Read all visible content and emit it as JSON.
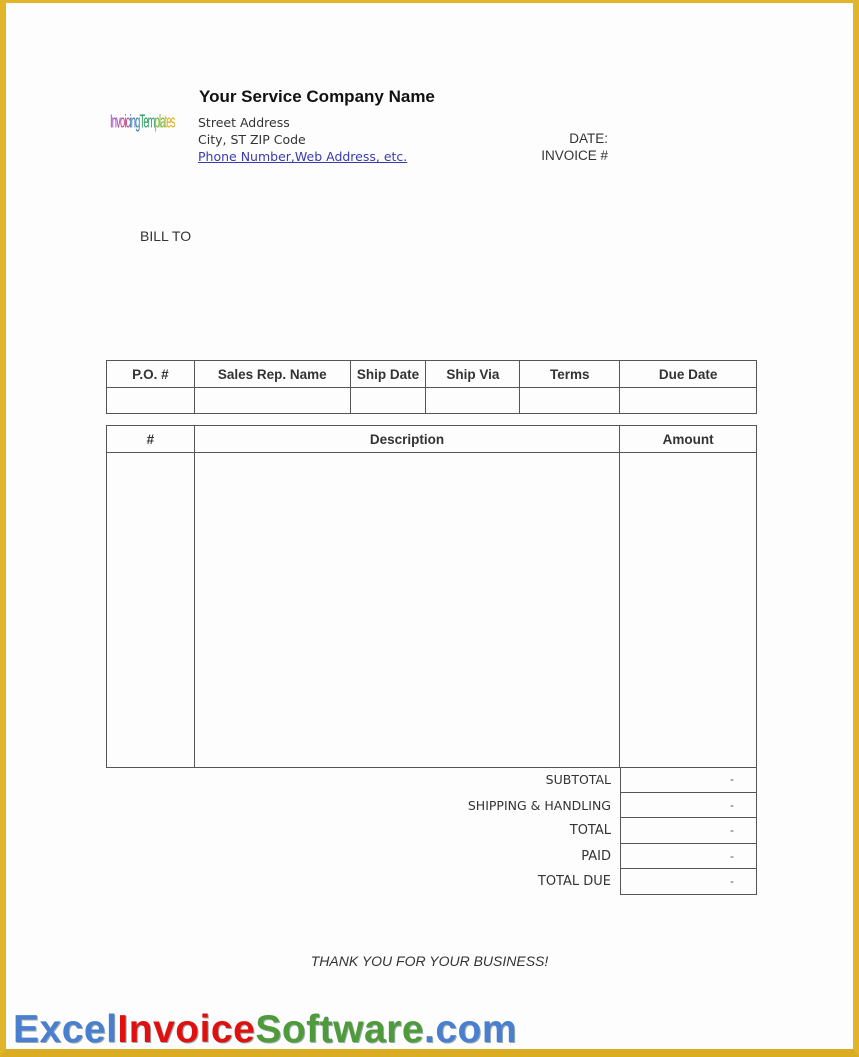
{
  "logo": {
    "parts": [
      {
        "text": "Inv",
        "color": "#a040c0"
      },
      {
        "text": "oic",
        "color": "#c04080"
      },
      {
        "text": "ing",
        "color": "#3a7ab0"
      },
      {
        "text": "Tem",
        "color": "#2a9a60"
      },
      {
        "text": "pla",
        "color": "#7ab030"
      },
      {
        "text": "tes",
        "color": "#e0b020"
      }
    ]
  },
  "company": {
    "name": "Your Service Company Name",
    "street": "Street Address",
    "city": "City, ST  ZIP Code",
    "contact": "Phone Number,Web Address, etc."
  },
  "meta": {
    "date_label": "DATE:",
    "invoice_label": "INVOICE #"
  },
  "bill_to_label": "BILL TO",
  "info_table": {
    "headers": [
      "P.O. #",
      "Sales Rep. Name",
      "Ship Date",
      "Ship Via",
      "Terms",
      "Due Date"
    ],
    "values": [
      "",
      "",
      "",
      "",
      "",
      ""
    ]
  },
  "items_table": {
    "headers": [
      "#",
      "Description",
      "Amount"
    ]
  },
  "totals": [
    {
      "label": "SUBTOTAL",
      "value": "-"
    },
    {
      "label": "SHIPPING & HANDLING",
      "value": "-"
    },
    {
      "label": "TOTAL",
      "value": "-"
    },
    {
      "label": "PAID",
      "value": "-"
    },
    {
      "label": "TOTAL DUE",
      "value": "-"
    }
  ],
  "footer": {
    "thanks": "THANK YOU FOR YOUR BUSINESS!"
  },
  "brand": {
    "parts": [
      {
        "text": "Excel",
        "color": "#4a7fd0"
      },
      {
        "text": "Invoice",
        "color": "#e01010"
      },
      {
        "text": "Software",
        "color": "#4f9a3a"
      },
      {
        "text": ".com",
        "color": "#4a7fd0"
      }
    ]
  }
}
